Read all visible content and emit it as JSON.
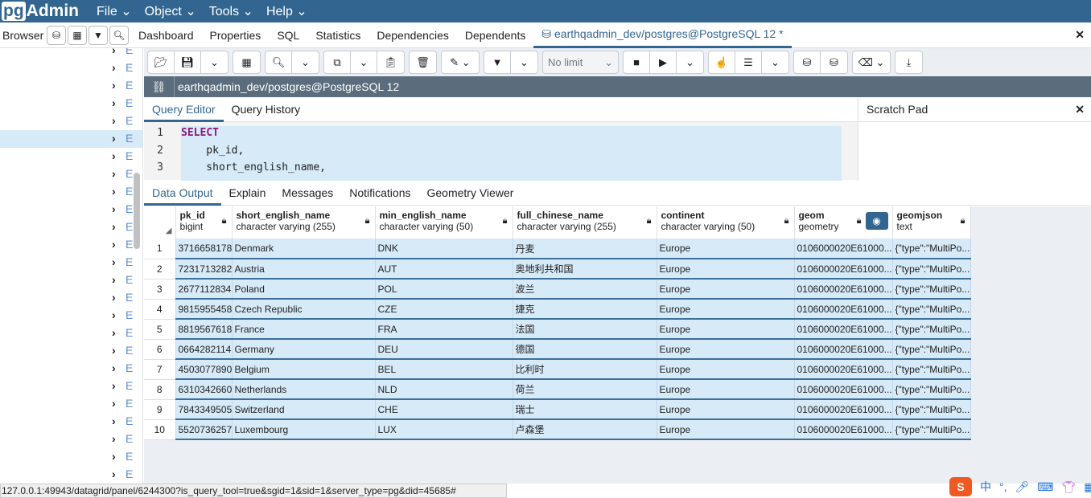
{
  "app": {
    "logo_pg": "pg",
    "logo_admin": "Admin",
    "menus": [
      "File",
      "Object",
      "Tools",
      "Help"
    ]
  },
  "browser": {
    "label": "Browser"
  },
  "tabs": [
    "Dashboard",
    "Properties",
    "SQL",
    "Statistics",
    "Dependencies",
    "Dependents"
  ],
  "active_tab": "earthqadmin_dev/postgres@PostgreSQL 12 *",
  "toolbar": {
    "limit": "No limit"
  },
  "connection": "earthqadmin_dev/postgres@PostgreSQL 12",
  "query_tabs": [
    "Query Editor",
    "Query History"
  ],
  "scratch_pad": "Scratch Pad",
  "editor": {
    "lines": [
      {
        "n": "1",
        "t": "SELECT"
      },
      {
        "n": "2",
        "t": "    pk_id,"
      },
      {
        "n": "3",
        "t": "    short_english_name,"
      }
    ]
  },
  "result_tabs": [
    "Data Output",
    "Explain",
    "Messages",
    "Notifications",
    "Geometry Viewer"
  ],
  "columns": [
    {
      "name": "pk_id",
      "type": "bigint"
    },
    {
      "name": "short_english_name",
      "type": "character varying (255)"
    },
    {
      "name": "min_english_name",
      "type": "character varying (50)"
    },
    {
      "name": "full_chinese_name",
      "type": "character varying (255)"
    },
    {
      "name": "continent",
      "type": "character varying (50)"
    },
    {
      "name": "geom",
      "type": "geometry"
    },
    {
      "name": "geomjson",
      "type": "text"
    }
  ],
  "rows": [
    [
      "1",
      "3716658178",
      "Denmark",
      "DNK",
      "丹麦",
      "Europe",
      "0106000020E61000...",
      "{\"type\":\"MultiPo..."
    ],
    [
      "2",
      "7231713282",
      "Austria",
      "AUT",
      "奥地利共和国",
      "Europe",
      "0106000020E61000...",
      "{\"type\":\"MultiPo..."
    ],
    [
      "3",
      "2677112834",
      "Poland",
      "POL",
      "波兰",
      "Europe",
      "0106000020E61000...",
      "{\"type\":\"MultiPo..."
    ],
    [
      "4",
      "9815955458",
      "Czech Republic",
      "CZE",
      "捷克",
      "Europe",
      "0106000020E61000...",
      "{\"type\":\"MultiPo..."
    ],
    [
      "5",
      "8819567618",
      "France",
      "FRA",
      "法国",
      "Europe",
      "0106000020E61000...",
      "{\"type\":\"MultiPo..."
    ],
    [
      "6",
      "0664282114",
      "Germany",
      "DEU",
      "德国",
      "Europe",
      "0106000020E61000...",
      "{\"type\":\"MultiPo..."
    ],
    [
      "7",
      "4503077890",
      "Belgium",
      "BEL",
      "比利时",
      "Europe",
      "0106000020E61000...",
      "{\"type\":\"MultiPo..."
    ],
    [
      "8",
      "6310342660",
      "Netherlands",
      "NLD",
      "荷兰",
      "Europe",
      "0106000020E61000...",
      "{\"type\":\"MultiPo..."
    ],
    [
      "9",
      "7843349505",
      "Switzerland",
      "CHE",
      "瑞士",
      "Europe",
      "0106000020E61000...",
      "{\"type\":\"MultiPo..."
    ],
    [
      "10",
      "5520736257",
      "Luxembourg",
      "LUX",
      "卢森堡",
      "Europe",
      "0106000020E61000...",
      "{\"type\":\"MultiPo..."
    ]
  ],
  "status_url": "127.0.0.1:49943/datagrid/panel/6244300?is_query_tool=true&sgid=1&sid=1&server_type=pg&did=45685#",
  "ime": {
    "lang": "中"
  },
  "colors": {
    "header": "#326690",
    "selection": "#d6eaf8",
    "connbar": "#5b6d7c"
  }
}
